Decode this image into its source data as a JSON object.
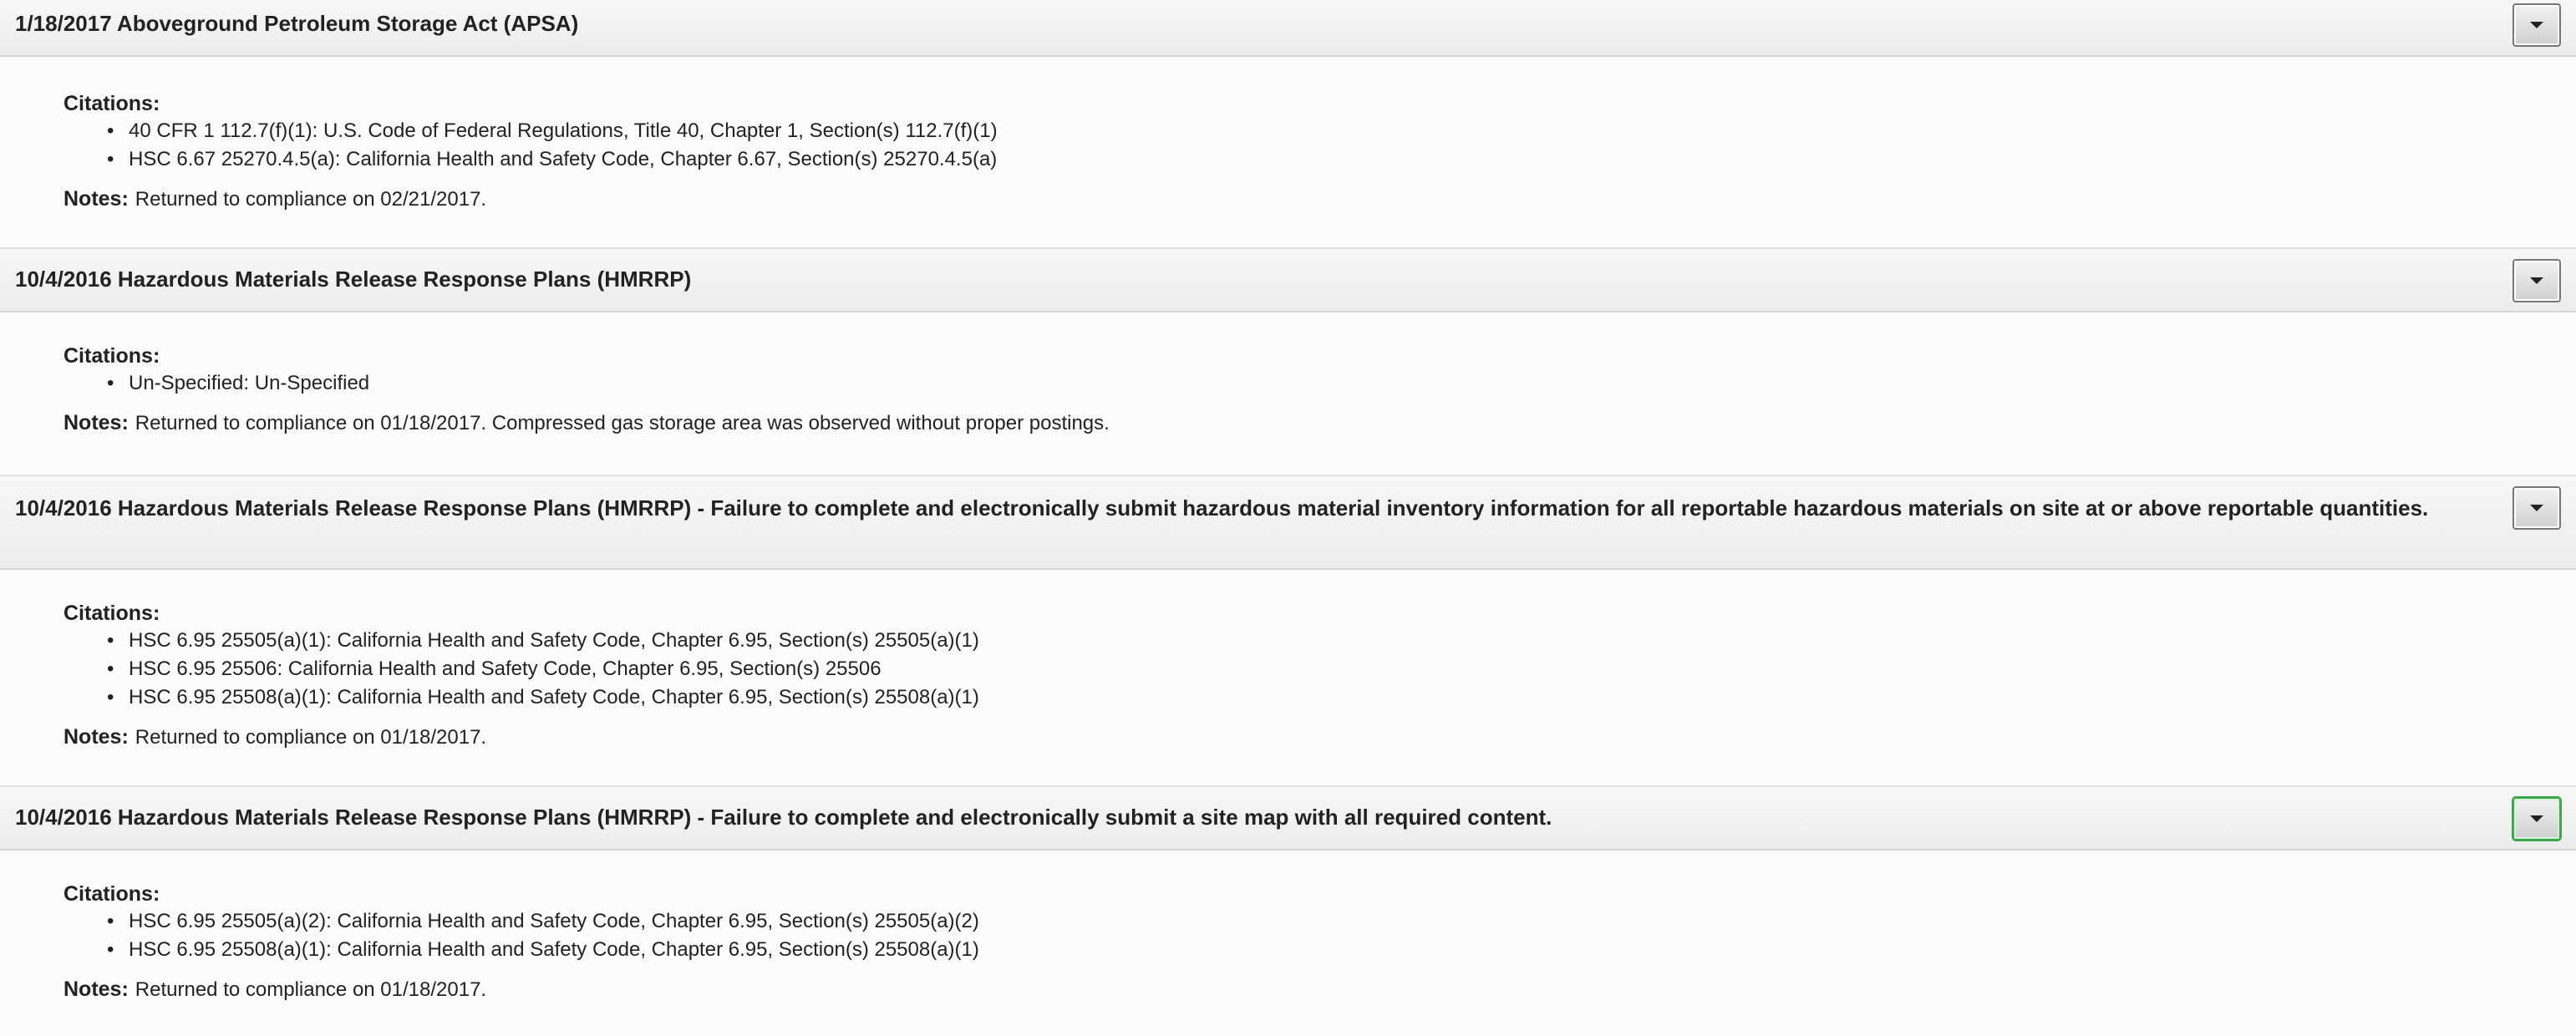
{
  "violations": [
    {
      "title": "1/18/2017 Aboveground Petroleum Storage Act (APSA)",
      "citations_label": "Citations:",
      "citations": [
        "40 CFR 1 112.7(f)(1): U.S. Code of Federal Regulations, Title 40, Chapter 1, Section(s) 112.7(f)(1)",
        "HSC 6.67 25270.4.5(a): California Health and Safety Code, Chapter 6.67, Section(s) 25270.4.5(a)"
      ],
      "notes_label": "Notes:",
      "notes": "Returned to compliance on 02/21/2017."
    },
    {
      "title": "10/4/2016 Hazardous Materials Release Response Plans (HMRRP)",
      "citations_label": "Citations:",
      "citations": [
        "Un-Specified: Un-Specified"
      ],
      "notes_label": "Notes:",
      "notes": "Returned to compliance on 01/18/2017. Compressed gas storage area was observed without proper postings."
    },
    {
      "title": "10/4/2016 Hazardous Materials Release Response Plans (HMRRP) - Failure to complete and electronically submit hazardous material inventory information for all reportable hazardous materials on site at or above reportable quantities.",
      "citations_label": "Citations:",
      "citations": [
        "HSC 6.95 25505(a)(1): California Health and Safety Code, Chapter 6.95, Section(s) 25505(a)(1)",
        "HSC 6.95 25506: California Health and Safety Code, Chapter 6.95, Section(s) 25506",
        "HSC 6.95 25508(a)(1): California Health and Safety Code, Chapter 6.95, Section(s) 25508(a)(1)"
      ],
      "notes_label": "Notes:",
      "notes": "Returned to compliance on 01/18/2017."
    },
    {
      "title": "10/4/2016 Hazardous Materials Release Response Plans (HMRRP) - Failure to complete and electronically submit a site map with all required content.",
      "citations_label": "Citations:",
      "citations": [
        "HSC 6.95 25505(a)(2): California Health and Safety Code, Chapter 6.95, Section(s) 25505(a)(2)",
        "HSC 6.95 25508(a)(1): California Health and Safety Code, Chapter 6.95, Section(s) 25508(a)(1)"
      ],
      "notes_label": "Notes:",
      "notes": "Returned to compliance on 01/18/2017."
    }
  ],
  "bullet_glyph": "•",
  "icons": {
    "toggle": "caret-down-icon"
  },
  "colors": {
    "focus_ring": "#3aa84a",
    "header_background": "#ececec",
    "page_background": "#fafafa"
  }
}
